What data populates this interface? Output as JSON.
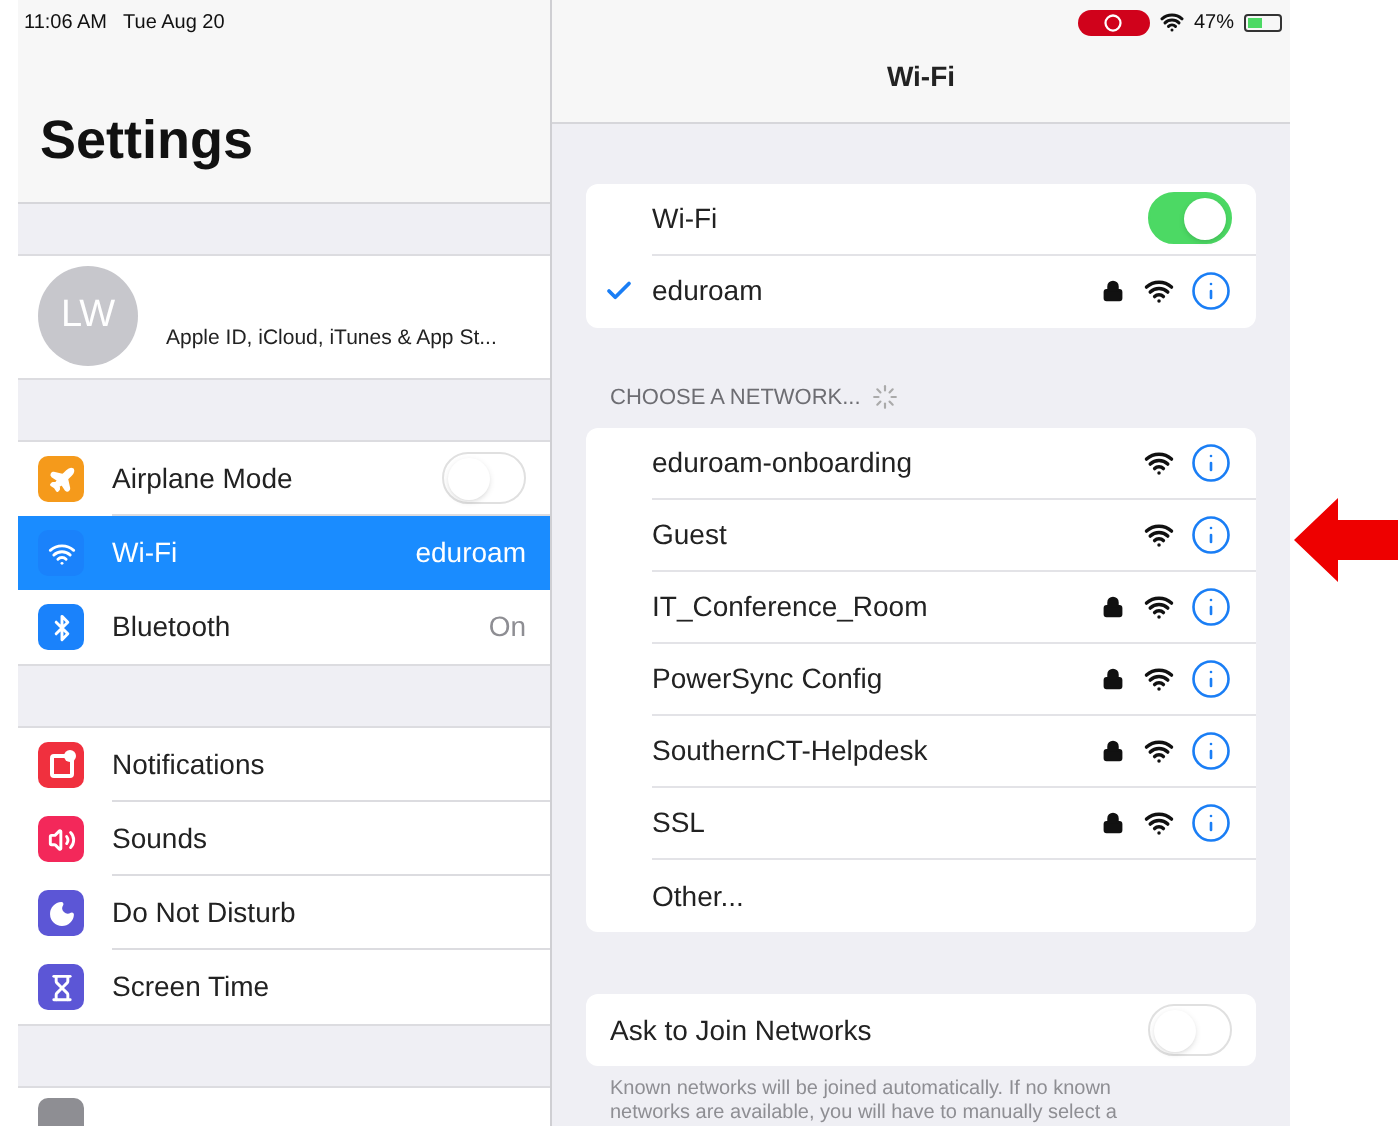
{
  "status_bar": {
    "time": "11:06 AM",
    "date": "Tue Aug 20",
    "battery": "47%",
    "recording": true
  },
  "sidebar": {
    "title": "Settings",
    "profile": {
      "initials": "LW",
      "subtitle": "Apple ID, iCloud, iTunes & App St..."
    },
    "groups": [
      [
        {
          "label": "Airplane Mode",
          "color": "#f59a1b",
          "kind": "toggle",
          "on": false,
          "selected": false
        },
        {
          "label": "Wi-Fi",
          "color": "#1a82fb",
          "kind": "value",
          "value": "eduroam",
          "selected": true
        },
        {
          "label": "Bluetooth",
          "color": "#1a82fb",
          "kind": "value",
          "value": "On",
          "selected": false
        }
      ],
      [
        {
          "label": "Notifications",
          "color": "#f0303e",
          "kind": "link",
          "selected": false
        },
        {
          "label": "Sounds",
          "color": "#f3285a",
          "kind": "link",
          "selected": false
        },
        {
          "label": "Do Not Disturb",
          "color": "#5c56d6",
          "kind": "link",
          "selected": false
        },
        {
          "label": "Screen Time",
          "color": "#5c56d6",
          "kind": "link",
          "selected": false
        }
      ]
    ]
  },
  "detail": {
    "title": "Wi-Fi",
    "wifi_row": {
      "label": "Wi-Fi",
      "on": true
    },
    "current": {
      "name": "eduroam",
      "locked": true
    },
    "section_header": "CHOOSE A NETWORK...",
    "networks": [
      {
        "name": "eduroam-onboarding",
        "locked": false
      },
      {
        "name": "Guest",
        "locked": false
      },
      {
        "name": "IT_Conference_Room",
        "locked": true
      },
      {
        "name": "PowerSync Config",
        "locked": true
      },
      {
        "name": "SouthernCT-Helpdesk",
        "locked": true
      },
      {
        "name": "SSL",
        "locked": true
      }
    ],
    "other": "Other...",
    "ask_to_join": {
      "label": "Ask to Join Networks",
      "on": false
    },
    "footer": "Known networks will be joined automatically. If no known networks are available, you will have to manually select a"
  }
}
